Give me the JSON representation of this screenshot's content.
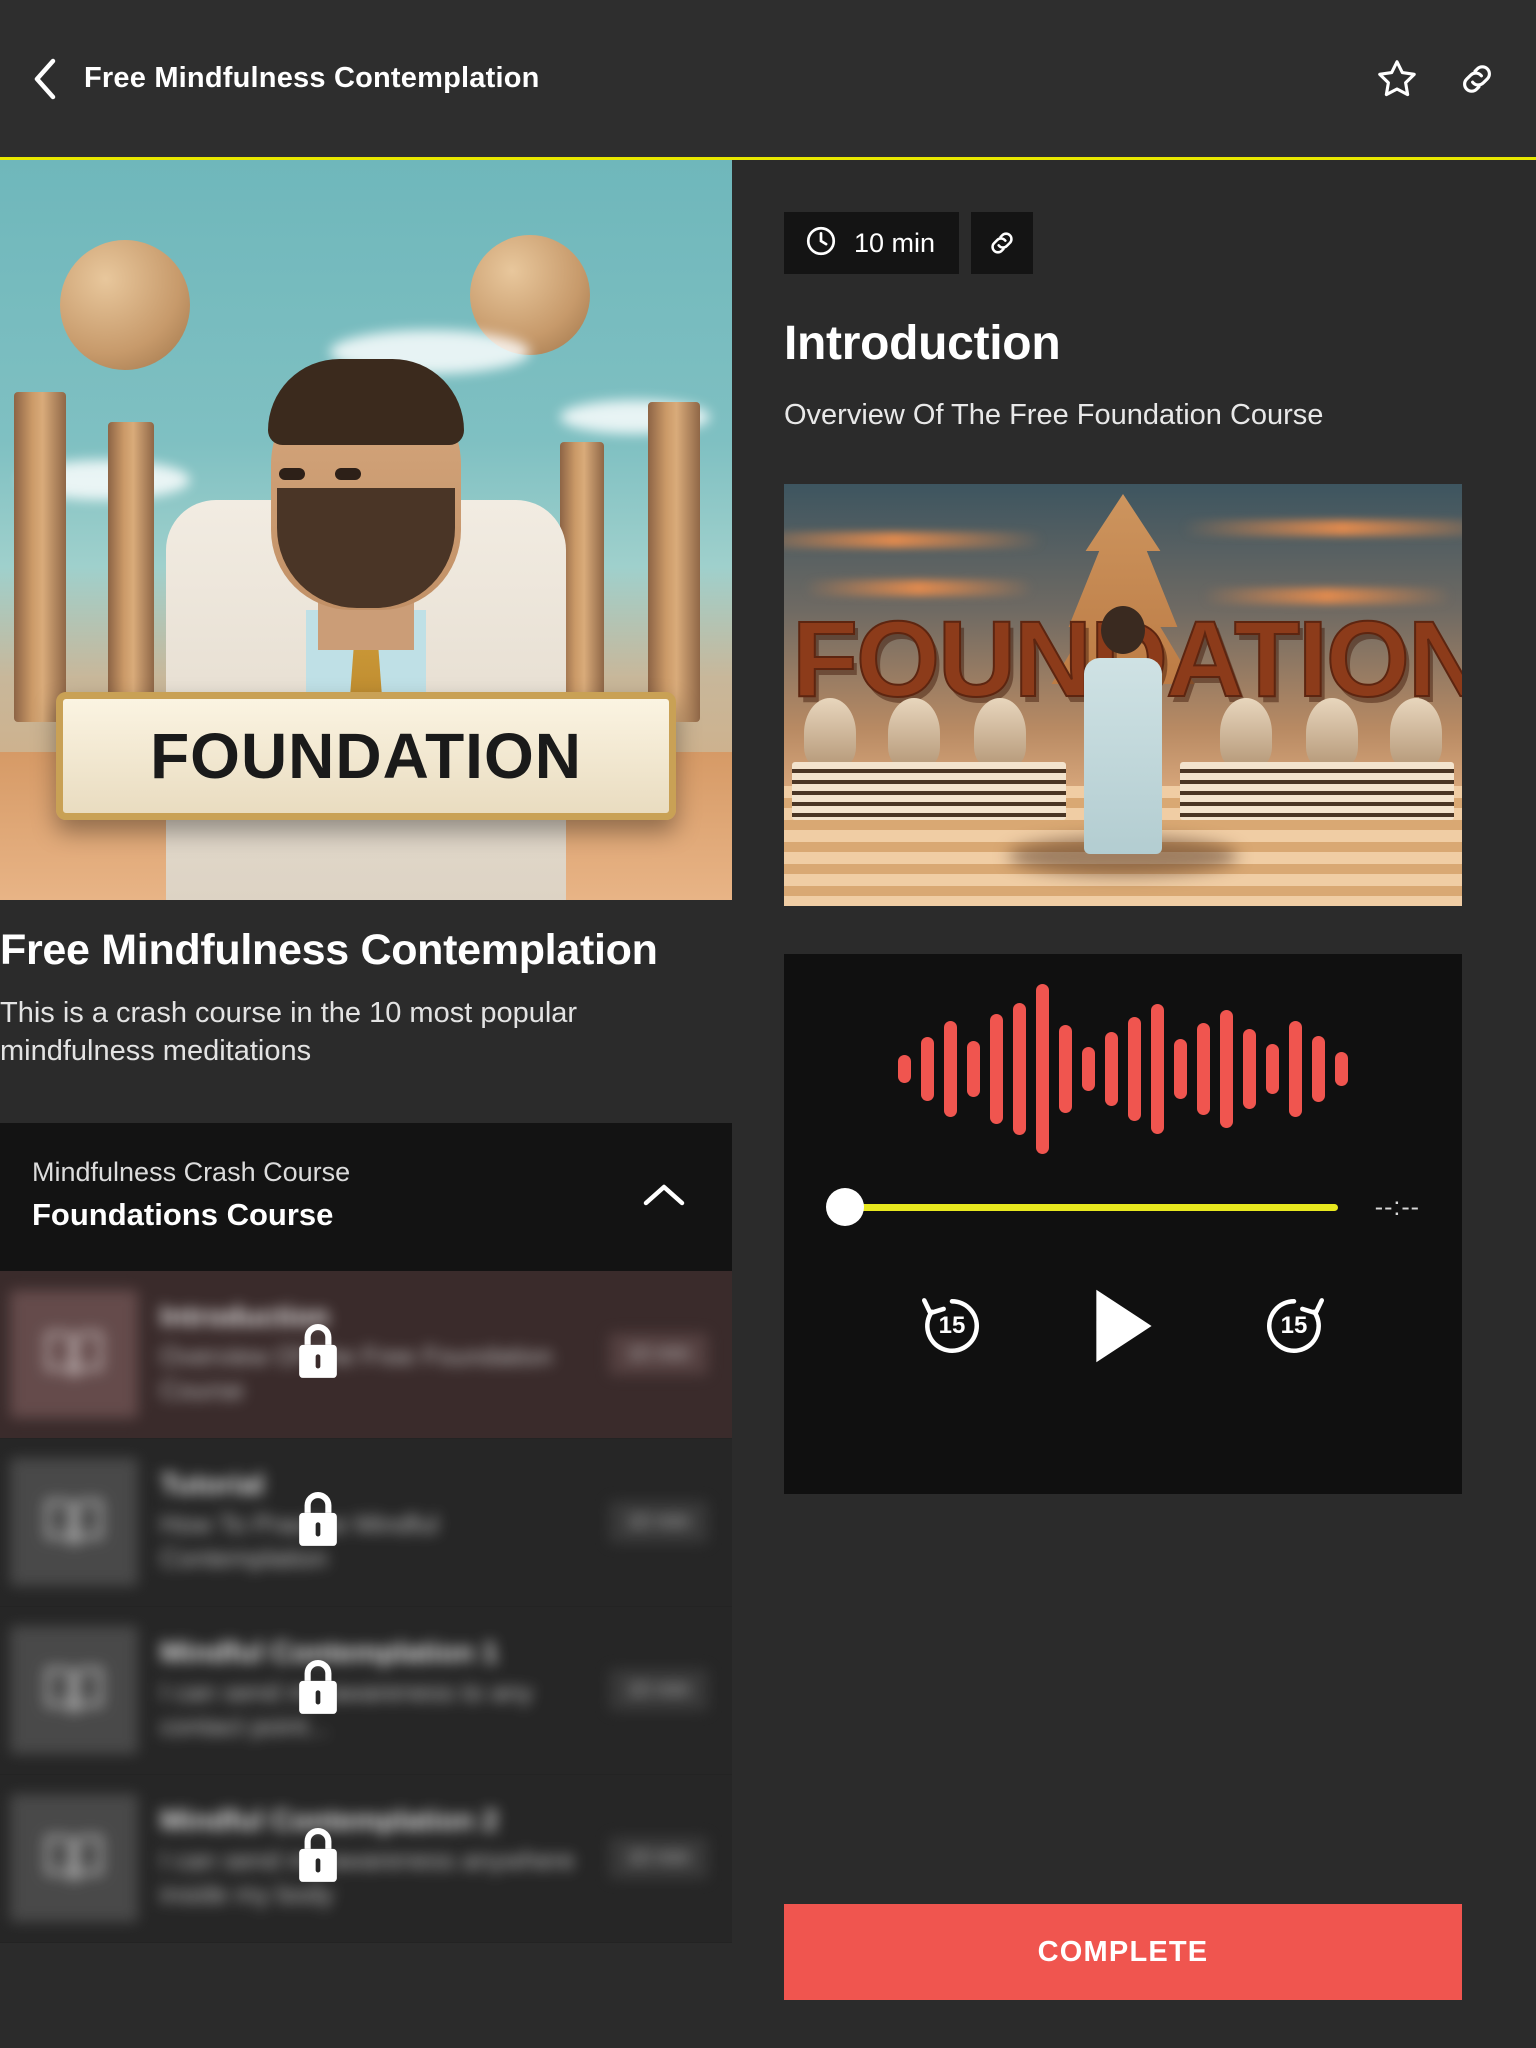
{
  "header": {
    "back_icon": "chevron-left-icon",
    "title": "Free Mindfulness Contemplation",
    "favorite_icon": "star-outline-icon",
    "share_icon": "link-icon"
  },
  "hero": {
    "plaque_text": "FOUNDATION"
  },
  "course": {
    "title": "Free Mindfulness Contemplation",
    "description": "This is a crash course in the 10 most popular mindfulness meditations"
  },
  "section": {
    "kicker": "Mindfulness Crash Course",
    "name": "Foundations Course",
    "collapse_icon": "chevron-up-icon"
  },
  "lessons": [
    {
      "title": "Introduction",
      "subtitle": "Overview Of The Free Foundation Course",
      "duration": "10 min",
      "locked": true,
      "active": true,
      "thumb_icon": "book-icon",
      "lock_icon": "lock-icon"
    },
    {
      "title": "Tutorial",
      "subtitle": "How To Practice Mindful Contemplation",
      "duration": "10 min",
      "locked": true,
      "active": false,
      "thumb_icon": "book-icon",
      "lock_icon": "lock-icon"
    },
    {
      "title": "Mindful Contemplation 1",
      "subtitle": "I can send my awareness to any contact  point...",
      "duration": "10 min",
      "locked": true,
      "active": false,
      "thumb_icon": "book-icon",
      "lock_icon": "lock-icon"
    },
    {
      "title": "Mindful Contemplation 2",
      "subtitle": "I can send my awareness anywhere inside my body",
      "duration": "10 min",
      "locked": true,
      "active": false,
      "thumb_icon": "book-icon",
      "lock_icon": "lock-icon"
    }
  ],
  "detail": {
    "clock_icon": "clock-icon",
    "duration": "10 min",
    "link_icon": "link-icon",
    "title": "Introduction",
    "subtitle": "Overview Of The Free Foundation Course",
    "banner_word": "FOUNDATION"
  },
  "player": {
    "waveform_color": "#f0554f",
    "progress_color": "#e8e81e",
    "time_display": "--:--",
    "progress_percent": 0,
    "rewind_icon": "rewind-15-icon",
    "rewind_label": "15",
    "play_icon": "play-icon",
    "forward_icon": "forward-15-icon",
    "forward_label": "15",
    "wave_bars": [
      28,
      64,
      96,
      56,
      110,
      132,
      170,
      88,
      44,
      74,
      104,
      130,
      60,
      92,
      118,
      80,
      50,
      96,
      66,
      34
    ]
  },
  "footer": {
    "complete_label": "COMPLETE",
    "complete_color": "#f0554f"
  }
}
